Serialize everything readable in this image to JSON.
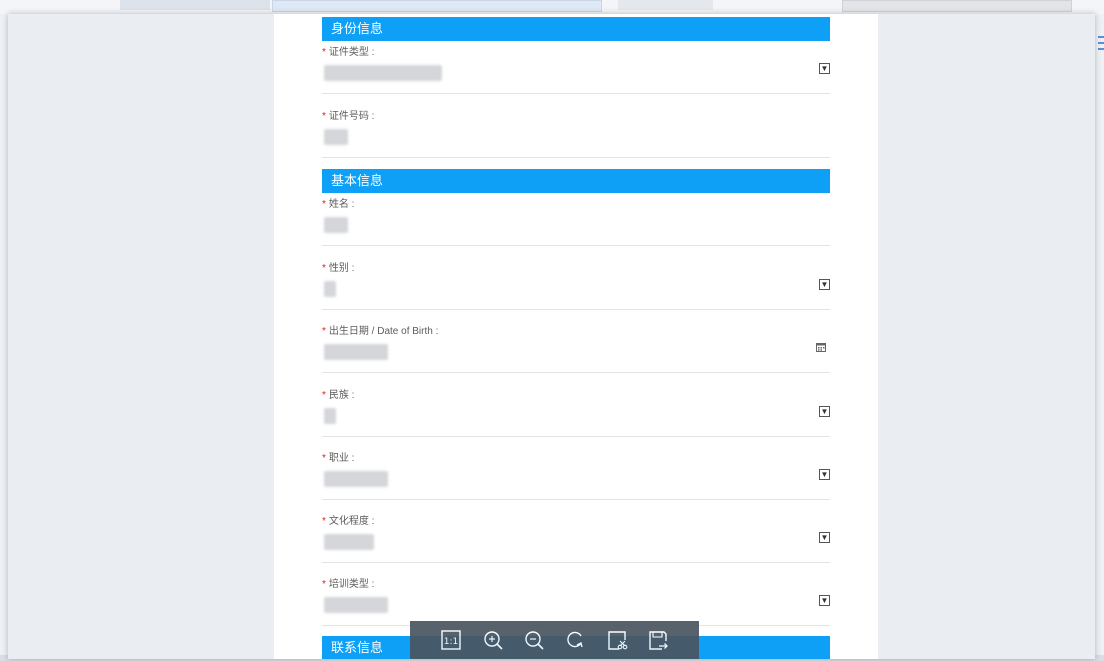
{
  "sections": {
    "identity": "身份信息",
    "basic": "基本信息",
    "contact": "联系信息"
  },
  "fields": {
    "id_type": {
      "label": "证件类型 :",
      "control": "select"
    },
    "id_number": {
      "label": "证件号码 :",
      "control": "text"
    },
    "name": {
      "label": "姓名 :",
      "control": "text"
    },
    "gender": {
      "label": "性别 :",
      "control": "select"
    },
    "birth_date": {
      "label": "出生日期 / Date of Birth :",
      "control": "date"
    },
    "ethnicity": {
      "label": "民族 :",
      "control": "select"
    },
    "occupation": {
      "label": "职业 :",
      "control": "select"
    },
    "education": {
      "label": "文化程度 :",
      "control": "select"
    },
    "training_type": {
      "label": "培训类型 :",
      "control": "select"
    }
  },
  "required_marker": "*",
  "toolbar": {
    "actual_size": "1:1",
    "icons": [
      "actual-size-icon",
      "zoom-in-icon",
      "zoom-out-icon",
      "rotate-icon",
      "crop-icon",
      "save-icon"
    ]
  },
  "colors": {
    "section_header": "#0ea0f6",
    "required": "#e02020",
    "toolbar": "#4a5560"
  }
}
